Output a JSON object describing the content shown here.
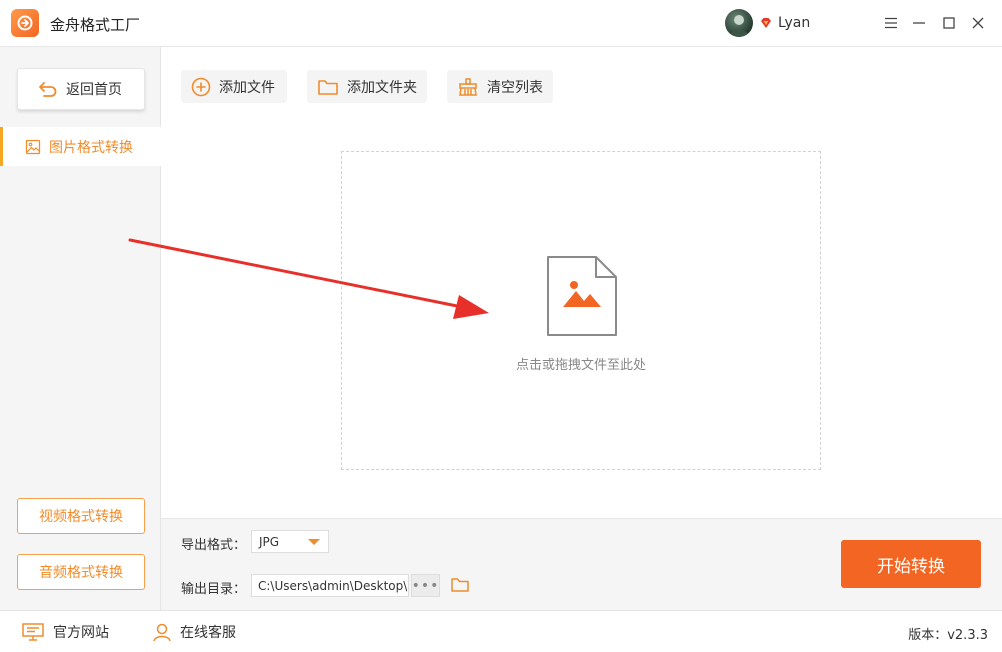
{
  "titlebar": {
    "app_title": "金舟格式工厂",
    "username": "Lyan"
  },
  "sidebar": {
    "back_label": "返回首页",
    "active_item": "图片格式转换",
    "video_btn": "视频格式转换",
    "audio_btn": "音频格式转换"
  },
  "toolbar": {
    "add_file": "添加文件",
    "add_folder": "添加文件夹",
    "clear_list": "清空列表"
  },
  "dropzone": {
    "hint": "点击或拖拽文件至此处"
  },
  "bottom": {
    "format_label": "导出格式：",
    "format_value": "JPG",
    "dir_label": "输出目录：",
    "dir_value": "C:\\Users\\admin\\Desktop\\",
    "dots": "•••",
    "start_label": "开始转换"
  },
  "status": {
    "website": "官方网站",
    "support": "在线客服",
    "version": "版本：v2.3.3"
  },
  "colors": {
    "accent": "#f26522",
    "accent_light": "#f08c2b",
    "arrow": "#e8302a"
  }
}
